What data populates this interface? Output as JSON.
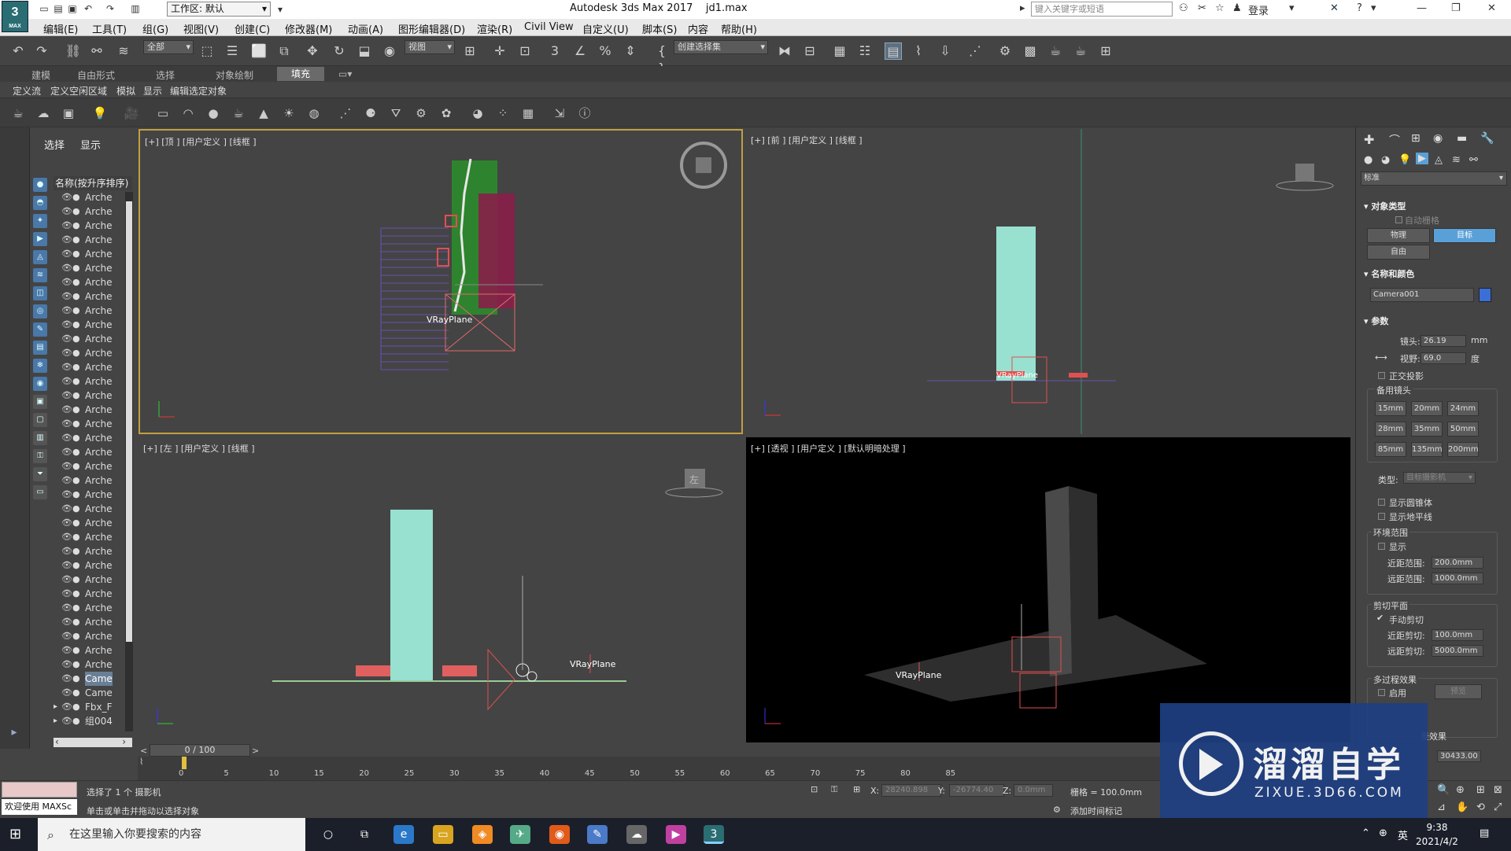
{
  "titlebar": {
    "logo_text": "3",
    "logo_sub": "MAX",
    "workspace": "工作区: 默认",
    "app_title": "Autodesk 3ds Max 2017",
    "file_name": "jd1.max",
    "search_placeholder": "键入关键字或短语",
    "login": "登录"
  },
  "menu": [
    "编辑(E)",
    "工具(T)",
    "组(G)",
    "视图(V)",
    "创建(C)",
    "修改器(M)",
    "动画(A)",
    "图形编辑器(D)",
    "渲染(R)",
    "Civil View",
    "自定义(U)",
    "脚本(S)",
    "内容",
    "帮助(H)"
  ],
  "toolbar": {
    "selection_filter": "全部",
    "ref_coord": "视图",
    "named_selection": "创建选择集"
  },
  "ribbon": {
    "tabs": [
      "建模",
      "自由形式",
      "选择",
      "对象绘制",
      "填充"
    ],
    "active_tab": "填充",
    "subtabs": [
      "定义流",
      "定义空闲区域",
      "模拟",
      "显示",
      "编辑选定对象"
    ]
  },
  "explorer": {
    "tabs": [
      "选择",
      "显示"
    ],
    "header": "名称(按升序排序)",
    "rows": [
      {
        "name": "Arche"
      },
      {
        "name": "Arche"
      },
      {
        "name": "Arche"
      },
      {
        "name": "Arche"
      },
      {
        "name": "Arche"
      },
      {
        "name": "Arche"
      },
      {
        "name": "Arche"
      },
      {
        "name": "Arche"
      },
      {
        "name": "Arche"
      },
      {
        "name": "Arche"
      },
      {
        "name": "Arche"
      },
      {
        "name": "Arche"
      },
      {
        "name": "Arche"
      },
      {
        "name": "Arche"
      },
      {
        "name": "Arche"
      },
      {
        "name": "Arche"
      },
      {
        "name": "Arche"
      },
      {
        "name": "Arche"
      },
      {
        "name": "Arche"
      },
      {
        "name": "Arche"
      },
      {
        "name": "Arche"
      },
      {
        "name": "Arche"
      },
      {
        "name": "Arche"
      },
      {
        "name": "Arche"
      },
      {
        "name": "Arche"
      },
      {
        "name": "Arche"
      },
      {
        "name": "Arche"
      },
      {
        "name": "Arche"
      },
      {
        "name": "Arche"
      },
      {
        "name": "Arche"
      },
      {
        "name": "Arche"
      },
      {
        "name": "Arche"
      },
      {
        "name": "Arche"
      },
      {
        "name": "Arche"
      },
      {
        "name": "Came",
        "selected": true
      },
      {
        "name": "Came"
      },
      {
        "name": "Fbx_F"
      },
      {
        "name": "组004"
      }
    ]
  },
  "viewports": {
    "top": {
      "label": "[+] [顶 ] [用户定义 ] [线框 ]",
      "plane_label": "VRayPlane"
    },
    "front": {
      "label": "[+] [前 ] [用户定义 ] [线框 ]",
      "plane_label": "VRayPlane"
    },
    "left": {
      "label": "[+] [左 ] [用户定义 ] [线框 ]",
      "plane_label": "VRayPlane",
      "cube_label": "左"
    },
    "persp": {
      "label": "[+] [透视 ] [用户定义 ] [默认明暗处理 ]",
      "plane_label": "VRayPlane"
    }
  },
  "command_panel": {
    "dropdown": "标准",
    "object_type_title": "对象类型",
    "auto_grid": "自动栅格",
    "btn_physical": "物理",
    "btn_target": "目标",
    "btn_free": "自由",
    "name_color_title": "名称和颜色",
    "object_name": "Camera001",
    "color": "#3b6fd8",
    "params_title": "参数",
    "lens_label": "镜头:",
    "lens_value": "26.19",
    "lens_unit": "mm",
    "fov_label": "视野:",
    "fov_value": "69.0",
    "fov_unit": "度",
    "ortho": "正交投影",
    "stock_lens_title": "备用镜头",
    "stock_lenses": [
      "15mm",
      "20mm",
      "24mm",
      "28mm",
      "35mm",
      "50mm",
      "85mm",
      "135mm",
      "200mm"
    ],
    "type_label": "类型:",
    "type_value": "目标摄影机",
    "show_cone": "显示圆锥体",
    "show_horizon": "显示地平线",
    "env_range_title": "环境范围",
    "env_show": "显示",
    "near_range_label": "近距范围:",
    "near_range_value": "200.0mm",
    "far_range_label": "远距范围:",
    "far_range_value": "1000.0mm",
    "clip_title": "剪切平面",
    "manual_clip": "手动剪切",
    "near_clip_label": "近距剪切:",
    "near_clip_value": "100.0mm",
    "far_clip_label": "远距剪切:",
    "far_clip_value": "5000.0mm",
    "multipass_title": "多过程效果",
    "enable": "启用",
    "preview": "预览",
    "effect_label": "景效果",
    "target_dist_value": "30433.00"
  },
  "timeline": {
    "slider": "0 / 100",
    "ticks": [
      "0",
      "5",
      "10",
      "15",
      "20",
      "25",
      "30",
      "35",
      "40",
      "45",
      "50",
      "55",
      "60",
      "65",
      "70",
      "75",
      "80",
      "85"
    ]
  },
  "status": {
    "welcome": "欢迎使用 MAXSc",
    "selected": "选择了 1 个 摄影机",
    "prompt": "单击或单击并拖动以选择对象",
    "x_label": "X:",
    "x_value": "28240.898",
    "y_label": "Y:",
    "y_value": "-26774.40",
    "z_label": "Z:",
    "z_value": "0.0mm",
    "grid": "栅格 = 100.0mm",
    "add_time_tag": "添加时间标记"
  },
  "watermark": {
    "big": "溜溜自学",
    "small": "ZIXUE.3D66.COM"
  },
  "taskbar": {
    "search_placeholder": "在这里输入你要搜索的内容",
    "ime": "英",
    "time": "9:38",
    "date": "2021/4/2"
  }
}
